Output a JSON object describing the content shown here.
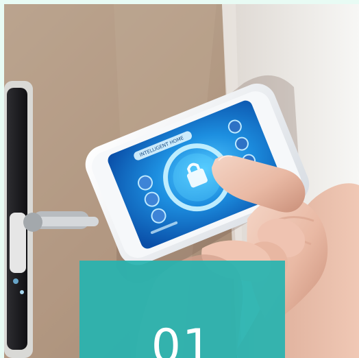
{
  "screen": {
    "overlay_number": "01",
    "device_label": "INTELLIGENT HOME"
  },
  "colors": {
    "page_background": "#e8fbf4",
    "overlay_card": "#26b3b0",
    "screen_primary": "#1d8fe0",
    "screen_secondary": "#0a4fa8"
  },
  "icons": [
    "lock-icon",
    "hand-icon",
    "smartphone-icon",
    "door-handle-icon"
  ]
}
